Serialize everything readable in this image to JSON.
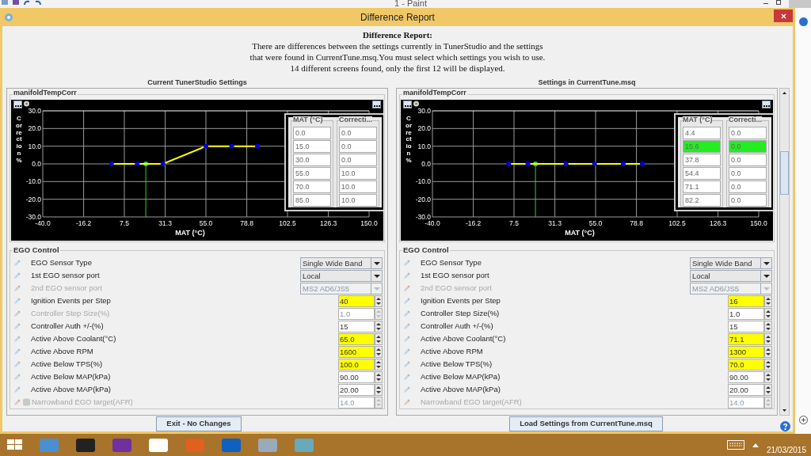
{
  "paint": {
    "title": "1 - Paint"
  },
  "dialog": {
    "title": "Difference Report"
  },
  "report": {
    "heading": "Difference Report:",
    "lines": [
      "There are differences between the settings currently in TunerStudio and the settings",
      "that were found in CurrentTune.msq.You must select which settings you wish to use.",
      "14 different screens found, only the first 12 will be displayed."
    ]
  },
  "panels": [
    {
      "heading": "Current TunerStudio Settings",
      "curve": {
        "title": "manifoldTempCorr",
        "chart_data": {
          "type": "line",
          "xlabel": "MAT (°C)",
          "ylabel": "Correction %",
          "x": [
            0,
            15,
            30,
            55,
            70,
            85
          ],
          "series": [
            {
              "color": "#ffff00",
              "marker": true,
              "values": [
                0,
                0,
                0,
                10,
                10,
                10
              ]
            }
          ],
          "grid": true,
          "xlim": [
            -40,
            150
          ],
          "ylim": [
            -30,
            30
          ],
          "xticks": [
            {
              "value": -40,
              "label": "-40.0"
            },
            {
              "value": -16.2,
              "label": "-16.2"
            },
            {
              "value": 7.5,
              "label": "7.5"
            },
            {
              "value": 31.3,
              "label": "31.3"
            },
            {
              "value": 55,
              "label": "55.0"
            },
            {
              "value": 78.8,
              "label": "78.8"
            },
            {
              "value": 102.5,
              "label": "102.5"
            },
            {
              "value": 126.3,
              "label": "126.3"
            },
            {
              "value": 150,
              "label": "150.0"
            }
          ],
          "yticks": [
            {
              "value": -30,
              "label": "-30.0"
            },
            {
              "value": -20,
              "label": "-20.0"
            },
            {
              "value": -10,
              "label": "-10.0"
            },
            {
              "value": 0,
              "label": "0.0"
            },
            {
              "value": 10,
              "label": "10.0"
            },
            {
              "value": 20,
              "label": "20.0"
            },
            {
              "value": 30,
              "label": "30.0"
            }
          ],
          "ref_lines": [
            {
              "axis": "x",
              "value": 20,
              "color": "#33cc33"
            }
          ]
        },
        "table": {
          "columns": [
            "MAT (°C)",
            "Correcti..."
          ],
          "rows": [
            {
              "cells": [
                "0.0",
                "0.0"
              ],
              "selected": false
            },
            {
              "cells": [
                "15.0",
                "0.0"
              ],
              "selected": false
            },
            {
              "cells": [
                "30.0",
                "0.0"
              ],
              "selected": false
            },
            {
              "cells": [
                "55.0",
                "10.0"
              ],
              "selected": false
            },
            {
              "cells": [
                "70.0",
                "10.0"
              ],
              "selected": false
            },
            {
              "cells": [
                "85.0",
                "10.0"
              ],
              "selected": false
            }
          ]
        }
      },
      "ego": {
        "title": "EGO Control",
        "rows": [
          {
            "label": "EGO Sensor Type",
            "kind": "select",
            "value": "Single Wide Band",
            "disabled": false,
            "changed": false,
            "help": false
          },
          {
            "label": "1st EGO sensor port",
            "kind": "select",
            "value": "Local",
            "disabled": false,
            "changed": false,
            "help": false
          },
          {
            "label": "2nd EGO sensor port",
            "kind": "select",
            "value": "MS2 AD6/JS5",
            "disabled": true,
            "changed": false,
            "help": false
          },
          {
            "label": "Ignition Events per Step",
            "kind": "spin",
            "value": "40",
            "disabled": false,
            "changed": true,
            "help": false
          },
          {
            "label": "Controller Step Size(%)",
            "kind": "spin",
            "value": "1.0",
            "disabled": true,
            "changed": false,
            "help": false
          },
          {
            "label": "Controller Auth +/-(%)",
            "kind": "spin",
            "value": "15",
            "disabled": false,
            "changed": false,
            "help": false
          },
          {
            "label": "Active Above Coolant(°C)",
            "kind": "spin",
            "value": "65.0",
            "disabled": false,
            "changed": true,
            "help": false
          },
          {
            "label": "Active Above RPM",
            "kind": "spin",
            "value": "1600",
            "disabled": false,
            "changed": true,
            "help": false
          },
          {
            "label": "Active Below TPS(%)",
            "kind": "spin",
            "value": "100.0",
            "disabled": false,
            "changed": true,
            "help": false
          },
          {
            "label": "Active Below MAP(kPa)",
            "kind": "spin",
            "value": "90.00",
            "disabled": false,
            "changed": false,
            "help": false
          },
          {
            "label": "Active Above MAP(kPa)",
            "kind": "spin",
            "value": "20.00",
            "disabled": false,
            "changed": false,
            "help": false
          },
          {
            "label": "Narrowband EGO target(AFR)",
            "kind": "spin",
            "value": "14.0",
            "disabled": true,
            "changed": false,
            "help": true
          }
        ]
      }
    },
    {
      "heading": "Settings in CurrentTune.msq",
      "curve": {
        "title": "manifoldTempCorr",
        "chart_data": {
          "type": "line",
          "xlabel": "MAT (°C)",
          "ylabel": "Correction %",
          "x": [
            4.4,
            15.6,
            37.8,
            54.4,
            71.1,
            82.2
          ],
          "series": [
            {
              "color": "#ffff00",
              "marker": true,
              "values": [
                0,
                0,
                0,
                0,
                0,
                0
              ]
            }
          ],
          "grid": true,
          "xlim": [
            -40,
            150
          ],
          "ylim": [
            -30,
            30
          ],
          "xticks": [
            {
              "value": -40,
              "label": "-40.0"
            },
            {
              "value": -16.2,
              "label": "-16.2"
            },
            {
              "value": 7.5,
              "label": "7.5"
            },
            {
              "value": 31.3,
              "label": "31.3"
            },
            {
              "value": 55,
              "label": "55.0"
            },
            {
              "value": 78.8,
              "label": "78.8"
            },
            {
              "value": 102.5,
              "label": "102.5"
            },
            {
              "value": 126.3,
              "label": "126.3"
            },
            {
              "value": 150,
              "label": "150.0"
            }
          ],
          "yticks": [
            {
              "value": -30,
              "label": "-30.0"
            },
            {
              "value": -20,
              "label": "-20.0"
            },
            {
              "value": -10,
              "label": "-10.0"
            },
            {
              "value": 0,
              "label": "0.0"
            },
            {
              "value": 10,
              "label": "10.0"
            },
            {
              "value": 20,
              "label": "20.0"
            },
            {
              "value": 30,
              "label": "30.0"
            }
          ],
          "ref_lines": [
            {
              "axis": "x",
              "value": 20,
              "color": "#33cc33"
            }
          ]
        },
        "table": {
          "columns": [
            "MAT (°C)",
            "Correcti..."
          ],
          "rows": [
            {
              "cells": [
                "4.4",
                "0.0"
              ],
              "selected": false
            },
            {
              "cells": [
                "15.6",
                "0.0"
              ],
              "selected": true
            },
            {
              "cells": [
                "37.8",
                "0.0"
              ],
              "selected": false
            },
            {
              "cells": [
                "54.4",
                "0.0"
              ],
              "selected": false
            },
            {
              "cells": [
                "71.1",
                "0.0"
              ],
              "selected": false
            },
            {
              "cells": [
                "82.2",
                "0.0"
              ],
              "selected": false
            }
          ]
        }
      },
      "ego": {
        "title": "EGO Control",
        "rows": [
          {
            "label": "EGO Sensor Type",
            "kind": "select",
            "value": "Single Wide Band",
            "disabled": false,
            "changed": false,
            "help": false
          },
          {
            "label": "1st EGO sensor port",
            "kind": "select",
            "value": "Local",
            "disabled": false,
            "changed": false,
            "help": false
          },
          {
            "label": "2nd EGO sensor port",
            "kind": "select",
            "value": "MS2 AD6/JS5",
            "disabled": true,
            "changed": false,
            "help": false
          },
          {
            "label": "Ignition Events per Step",
            "kind": "spin",
            "value": "16",
            "disabled": false,
            "changed": true,
            "help": false
          },
          {
            "label": "Controller Step Size(%)",
            "kind": "spin",
            "value": "1.0",
            "disabled": false,
            "changed": false,
            "help": false
          },
          {
            "label": "Controller Auth +/-(%)",
            "kind": "spin",
            "value": "15",
            "disabled": false,
            "changed": false,
            "help": false
          },
          {
            "label": "Active Above Coolant(°C)",
            "kind": "spin",
            "value": "71.1",
            "disabled": false,
            "changed": true,
            "help": false
          },
          {
            "label": "Active Above RPM",
            "kind": "spin",
            "value": "1300",
            "disabled": false,
            "changed": true,
            "help": false
          },
          {
            "label": "Active Below TPS(%)",
            "kind": "spin",
            "value": "70.0",
            "disabled": false,
            "changed": true,
            "help": false
          },
          {
            "label": "Active Below MAP(kPa)",
            "kind": "spin",
            "value": "90.00",
            "disabled": false,
            "changed": false,
            "help": false
          },
          {
            "label": "Active Above MAP(kPa)",
            "kind": "spin",
            "value": "20.00",
            "disabled": false,
            "changed": false,
            "help": false
          },
          {
            "label": "Narrowband EGO target(AFR)",
            "kind": "spin",
            "value": "14.0",
            "disabled": true,
            "changed": false,
            "help": false
          }
        ]
      }
    }
  ],
  "buttons": [
    {
      "label": "Exit - No Changes"
    },
    {
      "label": "Load Settings from CurrentTune.msq"
    }
  ],
  "taskbar": {
    "date": "21/03/2015"
  }
}
